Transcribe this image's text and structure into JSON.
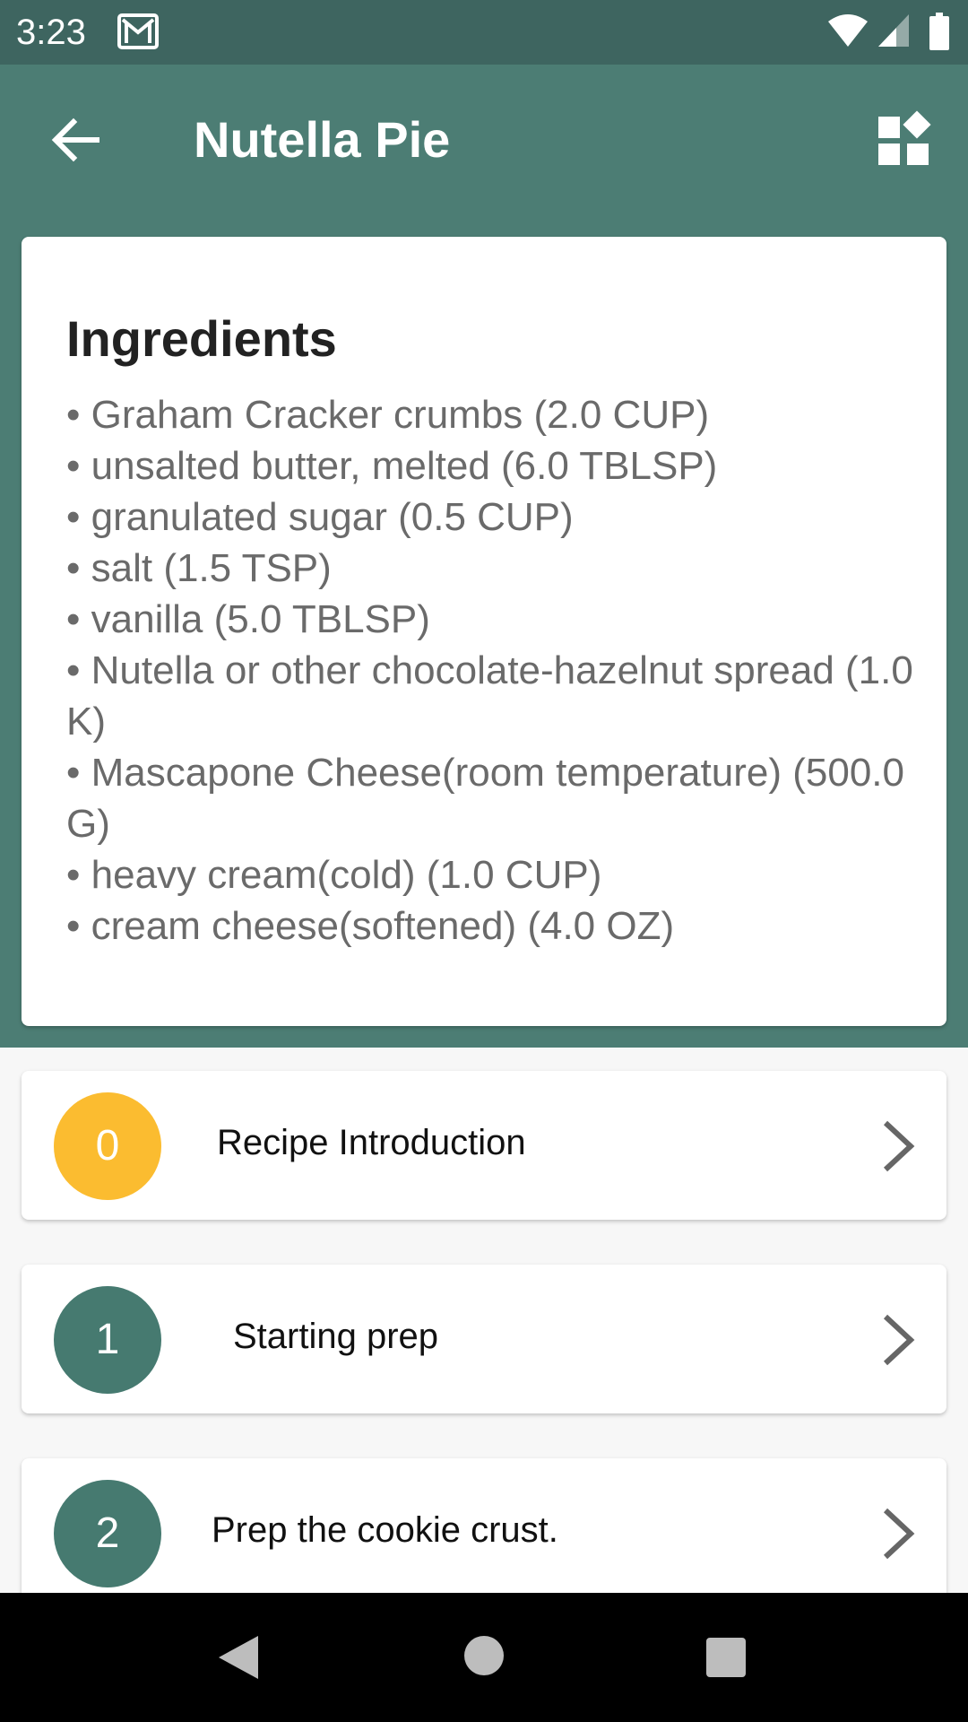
{
  "status_bar": {
    "time": "3:23",
    "icons": [
      "gmail-icon",
      "wifi-icon",
      "signal-icon",
      "battery-icon"
    ]
  },
  "app_bar": {
    "title": "Nutella Pie",
    "back_icon": "arrow-back-icon",
    "action_icon": "widgets-icon"
  },
  "ingredients": {
    "title": "Ingredients",
    "items": [
      "• Graham Cracker crumbs (2.0 CUP)",
      "• unsalted butter, melted (6.0 TBLSP)",
      "• granulated sugar (0.5 CUP)",
      "• salt (1.5 TSP)",
      "• vanilla (5.0 TBLSP)",
      "• Nutella or other chocolate-hazelnut spread (1.0 K)",
      "• Mascapone Cheese(room temperature) (500.0 G)",
      "• heavy cream(cold) (1.0 CUP)",
      "• cream cheese(softened) (4.0 OZ)"
    ]
  },
  "steps": [
    {
      "number": "0",
      "label": "Recipe Introduction",
      "color": "#fbbc30"
    },
    {
      "number": "1",
      "label": "Starting prep",
      "color": "#467a70"
    },
    {
      "number": "2",
      "label": "Prep the cookie crust.",
      "color": "#467a70"
    }
  ],
  "colors": {
    "primary": "#4c7d74",
    "primary_dark": "#3e6560",
    "accent": "#fbbc30"
  },
  "nav_bar": {
    "icons": [
      "nav-back-icon",
      "nav-home-icon",
      "nav-recents-icon"
    ]
  }
}
